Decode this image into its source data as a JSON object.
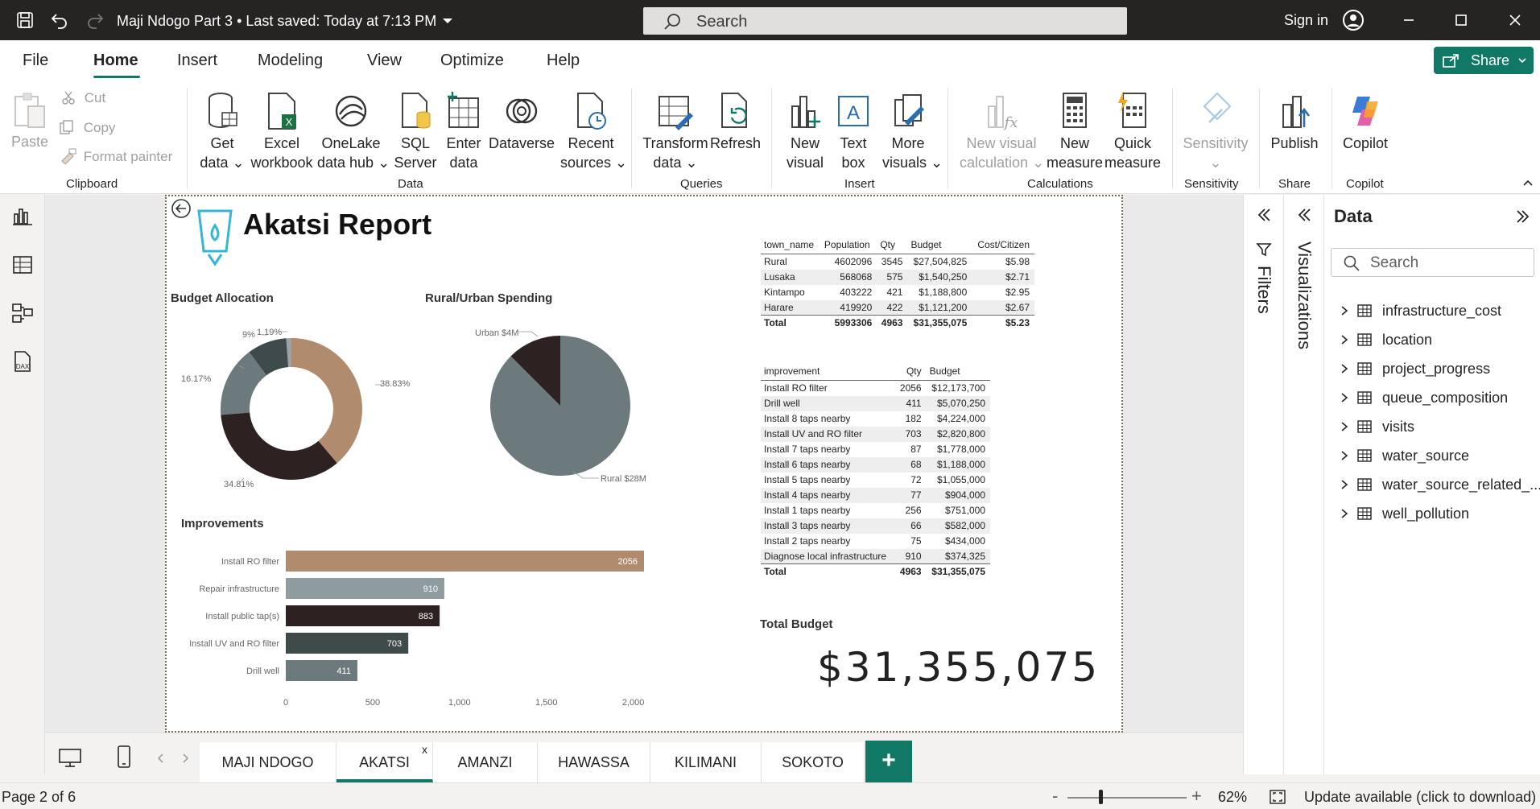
{
  "titlebar": {
    "doc_title": "Maji Ndogo Part 3 • Last saved: Today at 7:13 PM",
    "search_placeholder": "Search",
    "signin_label": "Sign in"
  },
  "menu": {
    "tabs": [
      "File",
      "Home",
      "Insert",
      "Modeling",
      "View",
      "Optimize",
      "Help"
    ],
    "active": "Home",
    "share_label": "Share"
  },
  "ribbon": {
    "clipboard": {
      "paste": "Paste",
      "cut": "Cut",
      "copy": "Copy",
      "format_painter": "Format painter",
      "group": "Clipboard"
    },
    "data": {
      "get_data": [
        "Get",
        "data"
      ],
      "excel": [
        "Excel",
        "workbook"
      ],
      "onelake": [
        "OneLake",
        "data hub"
      ],
      "sql": [
        "SQL",
        "Server"
      ],
      "enter": [
        "Enter",
        "data"
      ],
      "dataverse": "Dataverse",
      "recent": [
        "Recent",
        "sources"
      ],
      "group": "Data"
    },
    "queries": {
      "transform": [
        "Transform",
        "data"
      ],
      "refresh": "Refresh",
      "group": "Queries"
    },
    "insert": {
      "new_visual": [
        "New",
        "visual"
      ],
      "text_box": [
        "Text",
        "box"
      ],
      "more_visuals": [
        "More",
        "visuals"
      ],
      "group": "Insert"
    },
    "calculations": {
      "new_visual_calc": [
        "New visual",
        "calculation"
      ],
      "new_measure": [
        "New",
        "measure"
      ],
      "quick_measure": [
        "Quick",
        "measure"
      ],
      "group": "Calculations"
    },
    "sensitivity": {
      "label": "Sensitivity",
      "group": "Sensitivity"
    },
    "share": {
      "publish": "Publish",
      "group": "Share"
    },
    "copilot": {
      "label": "Copilot",
      "group": "Copilot"
    }
  },
  "report": {
    "title": "Akatsi Report",
    "budget_allocation": {
      "title": "Budget Allocation",
      "labels": [
        "38.83%",
        "34.81%",
        "16.17%",
        "9%",
        "1.19%"
      ]
    },
    "rural_urban": {
      "title": "Rural/Urban Spending",
      "labels": [
        "Urban $4M",
        "Rural $28M"
      ]
    },
    "improvements": {
      "title": "Improvements"
    },
    "town_table": {
      "headers": [
        "town_name",
        "Population",
        "Qty",
        "Budget",
        "Cost/Citizen"
      ],
      "rows": [
        [
          "Rural",
          "4602096",
          "3545",
          "$27,504,825",
          "$5.98"
        ],
        [
          "Lusaka",
          "568068",
          "575",
          "$1,540,250",
          "$2.71"
        ],
        [
          "Kintampo",
          "403222",
          "421",
          "$1,188,800",
          "$2.95"
        ],
        [
          "Harare",
          "419920",
          "422",
          "$1,121,200",
          "$2.67"
        ]
      ],
      "total": [
        "Total",
        "5993306",
        "4963",
        "$31,355,075",
        "$5.23"
      ]
    },
    "improvement_table": {
      "headers": [
        "improvement",
        "Qty",
        "Budget"
      ],
      "rows": [
        [
          "Install RO filter",
          "2056",
          "$12,173,700"
        ],
        [
          "Drill well",
          "411",
          "$5,070,250"
        ],
        [
          "Install 8 taps nearby",
          "182",
          "$4,224,000"
        ],
        [
          "Install UV and RO filter",
          "703",
          "$2,820,800"
        ],
        [
          "Install 7 taps nearby",
          "87",
          "$1,778,000"
        ],
        [
          "Install 6 taps nearby",
          "68",
          "$1,188,000"
        ],
        [
          "Install 5 taps nearby",
          "72",
          "$1,055,000"
        ],
        [
          "Install 4 taps nearby",
          "77",
          "$904,000"
        ],
        [
          "Install 1 taps nearby",
          "256",
          "$751,000"
        ],
        [
          "Install 3 taps nearby",
          "66",
          "$582,000"
        ],
        [
          "Install 2 taps nearby",
          "75",
          "$434,000"
        ],
        [
          "Diagnose local infrastructure",
          "910",
          "$374,325"
        ]
      ],
      "total": [
        "Total",
        "4963",
        "$31,355,075"
      ]
    },
    "total_budget": {
      "title": "Total Budget",
      "value": "$31,355,075"
    }
  },
  "chart_data": [
    {
      "type": "pie",
      "title": "Budget Allocation",
      "donut": true,
      "values": [
        38.83,
        34.81,
        16.17,
        9,
        1.19
      ],
      "colors": [
        "#b08b6e",
        "#2e2121",
        "#6c7a7d",
        "#3f4a4a",
        "#9aa4a6"
      ]
    },
    {
      "type": "pie",
      "title": "Rural/Urban Spending",
      "categories": [
        "Urban $4M",
        "Rural $28M"
      ],
      "values": [
        4,
        28
      ],
      "colors": [
        "#2e2121",
        "#6c7a7d"
      ]
    },
    {
      "type": "bar",
      "title": "Improvements",
      "orientation": "horizontal",
      "categories": [
        "Install RO filter",
        "Repair infrastructure",
        "Install public tap(s)",
        "Install UV and RO filter",
        "Drill well"
      ],
      "values": [
        2056,
        910,
        883,
        703,
        411
      ],
      "colors": [
        "#b08b6e",
        "#8f9c9f",
        "#2e2121",
        "#3f4a4a",
        "#6c7a7d"
      ],
      "xticks": [
        "0",
        "500",
        "1,000",
        "1,500",
        "2,000"
      ],
      "xlim": [
        0,
        2056
      ]
    }
  ],
  "side_panes": {
    "filters": "Filters",
    "visualizations": "Visualizations"
  },
  "data_pane": {
    "title": "Data",
    "search_placeholder": "Search",
    "tables": [
      "infrastructure_cost",
      "location",
      "project_progress",
      "queue_composition",
      "visits",
      "water_source",
      "water_source_related_...",
      "well_pollution"
    ]
  },
  "pages": {
    "tabs": [
      "MAJI NDOGO",
      "AKATSI",
      "AMANZI",
      "HAWASSA",
      "KILIMANI",
      "SOKOTO"
    ],
    "active": "AKATSI",
    "close_glyph": "x",
    "add_glyph": "+"
  },
  "status": {
    "page": "Page 2 of 6",
    "zoom": "62%",
    "update": "Update available (click to download)",
    "minus": "-",
    "plus": "+"
  },
  "colors": {
    "accent": "#117865",
    "titlebar": "#252423"
  }
}
